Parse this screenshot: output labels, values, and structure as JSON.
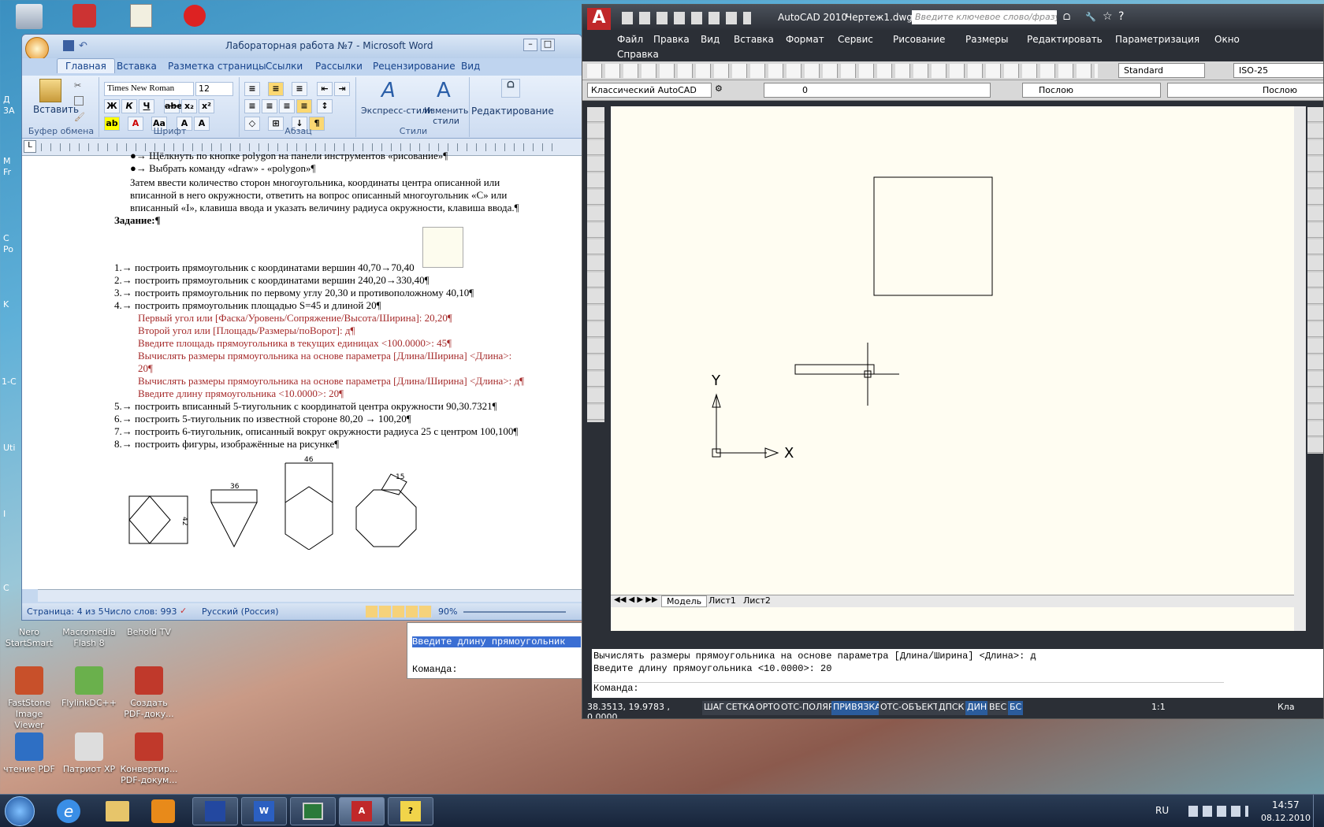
{
  "desktop": {
    "icons": [
      {
        "label": "Nero StartSmart"
      },
      {
        "label": "Macromedia Flash 8"
      },
      {
        "label": "Behold TV"
      },
      {
        "label": "FastStone Image Viewer"
      },
      {
        "label": "FlylinkDC++"
      },
      {
        "label": "Создать PDF-доку..."
      },
      {
        "label": "чтение PDF"
      },
      {
        "label": "Патриот XP"
      },
      {
        "label": "Конвертир... PDF-докум..."
      }
    ],
    "edge_labels": [
      "Д",
      "3А",
      "M",
      "Fr",
      "C",
      "Po",
      "K",
      "1-С",
      "Uti",
      "I",
      "C"
    ]
  },
  "word": {
    "title": "Лабораторная работа №7 - Microsoft Word",
    "tabs": [
      "Главная",
      "Вставка",
      "Разметка страницы",
      "Ссылки",
      "Рассылки",
      "Рецензирование",
      "Вид"
    ],
    "font": "Times New Roman",
    "size": "12",
    "groups": {
      "clipboard": "Буфер обмена",
      "paste": "Вставить",
      "font": "Шрифт",
      "paragraph": "Абзац",
      "styles": "Стили",
      "quick_styles": "Экспресс-стили",
      "change_styles": "Изменить стили",
      "editing": "Редактирование"
    },
    "lines": [
      "●→ Щёлкнуть по кнопке polygon на панели инструментов «рисование»¶",
      "●→ Выбрать команду «draw» - «polygon»¶",
      "Затем ввести количество сторон многоугольника, координаты центра описанной или",
      "вписанной в него окружности, ответить на вопрос описанный многоугольник «С» или",
      "вписанный «I», клавиша ввода и указать величину радиуса окружности, клавиша ввода.¶",
      "Задание:¶",
      "1.→ построить прямоугольник с координатами вершин 40,70→70,40",
      "2.→ построить прямоугольник с координатами вершин 240,20→330,40¶",
      "3.→ построить прямоугольник по первому углу 20,30 и противоположному 40,10¶",
      "4.→ построить прямоугольник площадью S=45 и длиной 20¶",
      "Первый угол или [Фаска/Уровень/Сопряжение/Высота/Ширина]: 20,20¶",
      "Второй угол или [Площадь/Размеры/поВорот]: д¶",
      "Введите площадь прямоугольника в текущих единицах <100.0000>: 45¶",
      "Вычислять размеры прямоугольника на основе параметра [Длина/Ширина] <Длина>:",
      "20¶",
      "Вычислять размеры прямоугольника на основе параметра [Длина/Ширина] <Длина>: д¶",
      "Введите длину прямоугольника <10.0000>: 20¶",
      "5.→ построить вписанный 5-тиугольник с координатой центра окружности 90,30.7321¶",
      "6.→ построить 5-тиугольник по известной стороне 80,20   →   100,20¶",
      "7.→ построить 6-тиугольник, описанный вокруг окружности радиуса 25 с центром 100,100¶",
      "8.→ построить фигуры, изображённые на рисунке¶"
    ],
    "figure_labels": [
      "42",
      "36",
      "46",
      "15"
    ],
    "status": {
      "page": "Страница: 4 из 5",
      "words": "Число слов: 993",
      "lang": "Русский (Россия)",
      "zoom": "90%"
    }
  },
  "acad": {
    "title": "AutoCAD 2010",
    "file": "Чертеж1.dwg",
    "search_placeholder": "Введите ключевое слово/фразу",
    "menu": [
      "Файл",
      "Правка",
      "Вид",
      "Вставка",
      "Формат",
      "Сервис",
      "Рисование",
      "Размеры",
      "Редактировать",
      "Параметризация",
      "Окно",
      "Справка"
    ],
    "workspace": "Классический AutoCAD",
    "layer": "0",
    "style": "Standard",
    "dimstyle": "ISO-25",
    "color": "Послою",
    "linetype": "Послою",
    "tabs": [
      "Модель",
      "Лист1",
      "Лист2"
    ],
    "axis_x": "X",
    "axis_y": "Y",
    "cmd_lines": [
      "Вычислять размеры прямоугольника на основе параметра [Длина/Ширина] <Длина>: д",
      "Введите длину прямоугольника <10.0000>: 20",
      "Команда:"
    ],
    "coords": "38.3513, 19.9783 , 0.0000",
    "status_buttons": [
      "ШАГ",
      "СЕТКА",
      "ОРТО",
      "ОТС-ПОЛЯР",
      "ПРИВЯЗКА",
      "ОТС-ОБЪЕКТ",
      "ДПСК",
      "ДИН",
      "ВЕС",
      "БС"
    ],
    "scale": "1:1",
    "kl": "Кла"
  },
  "behind": {
    "line1": "Введите длину прямоугольник",
    "line2": "Команда:"
  },
  "taskbar": {
    "lang": "RU",
    "time": "14:57",
    "date": "08.12.2010"
  }
}
